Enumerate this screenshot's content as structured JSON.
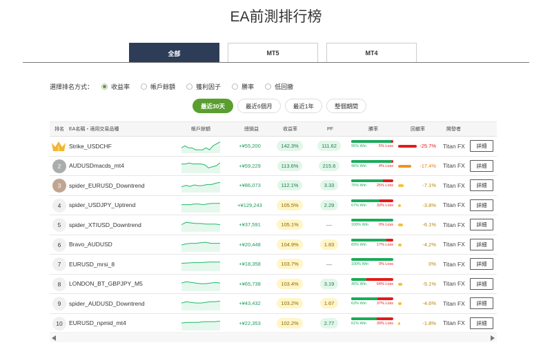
{
  "title": "EA前測排行榜",
  "tabs": [
    {
      "label": "全部",
      "active": true
    },
    {
      "label": "MT5",
      "active": false
    },
    {
      "label": "MT4",
      "active": false
    }
  ],
  "sort": {
    "label": "選擇排名方式：",
    "options": [
      {
        "label": "收益率",
        "selected": true
      },
      {
        "label": "帳戶餘額",
        "selected": false
      },
      {
        "label": "獲利因子",
        "selected": false
      },
      {
        "label": "勝率",
        "selected": false
      },
      {
        "label": "低回撤",
        "selected": false
      }
    ]
  },
  "periods": [
    {
      "label": "最近30天",
      "active": true
    },
    {
      "label": "最近6個月",
      "active": false
    },
    {
      "label": "最近1年",
      "active": false
    },
    {
      "label": "整個期間",
      "active": false
    }
  ],
  "headers": {
    "rank": "排名",
    "name": "EA名稱・適用交易品種",
    "balance": "帳戶餘額",
    "pnl": "總損益",
    "ret": "收益率",
    "pf": "PF",
    "win": "勝率",
    "dd": "回撤率",
    "dev": "開發者"
  },
  "colors": {
    "accent": "#5a9e2f",
    "tab_active": "#2d3c57",
    "win": "#1aab5a",
    "loss": "#e21b1b",
    "dd_high": "#e21b1b",
    "dd_mid": "#f0931e",
    "dd_low": "#f2c23c"
  },
  "detail_label": "詳細",
  "rows": [
    {
      "rank": "1",
      "name": "Strike_USDCHF",
      "pnl": "+¥55,200",
      "ret": "142.3%",
      "pf": "111.62",
      "win": 95,
      "win_label": "95% Win",
      "loss_label": "5% Loss",
      "dd": "-25.7%",
      "dd_value": 25.7,
      "dev": "Titan FX",
      "trend": [
        5,
        6,
        5,
        5,
        4,
        4,
        4,
        5,
        4,
        6,
        7,
        8
      ]
    },
    {
      "rank": "2",
      "name": "AUDUSDmacds_mt4",
      "pnl": "+¥59,229",
      "ret": "113.6%",
      "pf": "215.6",
      "win": 96,
      "win_label": "96% Win",
      "loss_label": "4% Loss",
      "dd": "-17.4%",
      "dd_value": 17.4,
      "dev": "Titan FX",
      "trend": [
        6,
        6,
        6.2,
        6,
        6,
        6,
        5.8,
        5,
        5.3,
        5.5,
        6.3
      ]
    },
    {
      "rank": "3",
      "name": "spider_EURUSD_Downtrend",
      "pnl": "+¥86,073",
      "ret": "112.1%",
      "pf": "3.33",
      "win": 75,
      "win_label": "75% Win",
      "loss_label": "25% Loss",
      "dd": "-7.1%",
      "dd_value": 7.1,
      "dev": "Titan FX",
      "trend": [
        6,
        6.3,
        6.1,
        6.4,
        6.2,
        6.3,
        6.5,
        6.5,
        6.8,
        7
      ]
    },
    {
      "rank": "4",
      "name": "spider_USDJPY_Uptrend",
      "pnl": "+¥129,243",
      "ret": "105.5%",
      "pf": "2.29",
      "win": 67,
      "win_label": "67% Win",
      "loss_label": "33% Loss",
      "dd": "-3.8%",
      "dd_value": 3.8,
      "dev": "Titan FX",
      "trend": [
        7,
        7,
        7,
        7.1,
        7.1,
        7,
        7.1,
        7.2,
        7.2,
        7.2
      ]
    },
    {
      "rank": "5",
      "name": "spider_XTIUSD_Downtrend",
      "pnl": "+¥37,591",
      "ret": "105.1%",
      "pf": "—",
      "win": 100,
      "win_label": "100% Win",
      "loss_label": "0% Loss",
      "dd": "-6.1%",
      "dd_value": 6.1,
      "dev": "Titan FX",
      "trend": [
        7,
        7.4,
        7.3,
        7.2,
        7.2,
        7.1,
        7.1,
        7.1,
        7
      ]
    },
    {
      "rank": "6",
      "name": "Bravo_AUDUSD",
      "pnl": "+¥20,448",
      "ret": "104.9%",
      "pf": "1.83",
      "win": 83,
      "win_label": "83% Win",
      "loss_label": "17% Loss",
      "dd": "-4.2%",
      "dd_value": 4.2,
      "dev": "Titan FX",
      "trend": [
        7,
        7.2,
        7.3,
        7.3,
        7.4,
        7.5,
        7.3,
        7.3,
        7.3
      ]
    },
    {
      "rank": "7",
      "name": "EURUSD_mrsi_8",
      "pnl": "+¥18,358",
      "ret": "103.7%",
      "pf": "—",
      "win": 100,
      "win_label": "100% Win",
      "loss_label": "0% Loss",
      "dd": "0%",
      "dd_value": 0,
      "dev": "Titan FX",
      "trend": [
        7,
        7.05,
        7.1,
        7.1,
        7.15,
        7.2,
        7.2,
        7.2
      ]
    },
    {
      "rank": "8",
      "name": "LONDON_BT_GBPJPY_M5",
      "pnl": "+¥65,738",
      "ret": "103.4%",
      "pf": "3.19",
      "win": 36,
      "win_label": "36% Win",
      "loss_label": "64% Loss",
      "dd": "-5.1%",
      "dd_value": 5.1,
      "dev": "Titan FX",
      "trend": [
        7,
        7.2,
        7.1,
        7,
        6.9,
        6.9,
        7,
        7.1,
        7
      ]
    },
    {
      "rank": "9",
      "name": "spider_AUDUSD_Downtrend",
      "pnl": "+¥43,432",
      "ret": "103.2%",
      "pf": "1.67",
      "win": 63,
      "win_label": "63% Win",
      "loss_label": "37% Loss",
      "dd": "-4.6%",
      "dd_value": 4.6,
      "dev": "Titan FX",
      "trend": [
        7,
        7.2,
        7.1,
        7,
        7,
        7.1,
        7.2,
        7.2,
        7.3
      ]
    },
    {
      "rank": "10",
      "name": "EURUSD_npmid_mt4",
      "pnl": "+¥22,353",
      "ret": "102.2%",
      "pf": "2.77",
      "win": 61,
      "win_label": "61% Win",
      "loss_label": "39% Loss",
      "dd": "-1.8%",
      "dd_value": 1.8,
      "dev": "Titan FX",
      "trend": [
        7,
        7.1,
        7.1,
        7.1,
        7.2,
        7.2,
        7.2,
        7.3
      ]
    }
  ]
}
